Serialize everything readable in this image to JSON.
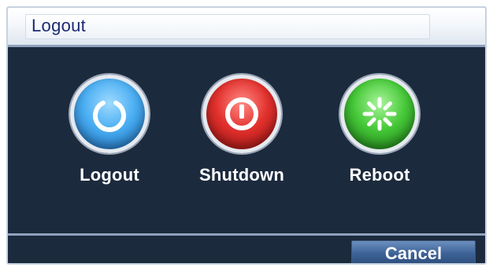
{
  "dialog": {
    "title": "Logout"
  },
  "actions": [
    {
      "label": "Logout",
      "icon": "power-icon",
      "color": "#4aaef2"
    },
    {
      "label": "Shutdown",
      "icon": "power-off-icon",
      "color": "#e2312d"
    },
    {
      "label": "Reboot",
      "icon": "reboot-spinner-icon",
      "color": "#46c838"
    }
  ],
  "footer": {
    "cancel_label": "Cancel"
  },
  "colors": {
    "background": "#1c2a3e",
    "title_text": "#1d2a74",
    "accent_border": "#8fa2bd"
  }
}
